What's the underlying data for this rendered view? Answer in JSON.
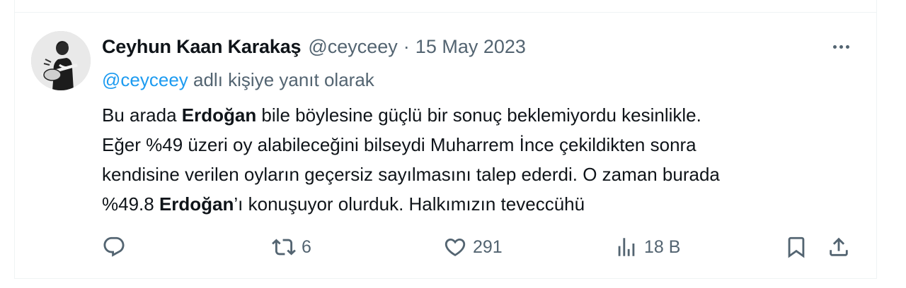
{
  "tweet": {
    "author_name": "Ceyhun Kaan Karakaş",
    "handle": "@ceyceey",
    "separator": "·",
    "date": "15 May 2023",
    "reply_mention": "@ceyceey",
    "reply_suffix": " adlı kişiye yanıt olarak",
    "body": {
      "l1a": "Bu arada ",
      "l1b": "Erdoğan",
      "l1c": " bile böylesine güçlü bir sonuç beklemiyordu kesinlikle.",
      "l2": "Eğer %49 üzeri oy alabileceğini bilseydi Muharrem İnce çekildikten sonra",
      "l3": "kendisine verilen oyların geçersiz sayılmasını talep ederdi. O zaman burada",
      "l4a": "%49.8 ",
      "l4b": "Erdoğan",
      "l4c": "’ı konuşuyor olurduk. Halkımızın teveccühü"
    }
  },
  "actions": {
    "reply_icon": "reply-icon",
    "retweet_icon": "retweet-icon",
    "retweet_count": "6",
    "like_icon": "heart-icon",
    "like_count": "291",
    "views_icon": "views-icon",
    "views_count": "18 B",
    "bookmark_icon": "bookmark-icon",
    "share_icon": "share-icon"
  },
  "colors": {
    "text": "#0f1419",
    "muted": "#536471",
    "link": "#1d9bf0",
    "border": "#eff3f4"
  }
}
